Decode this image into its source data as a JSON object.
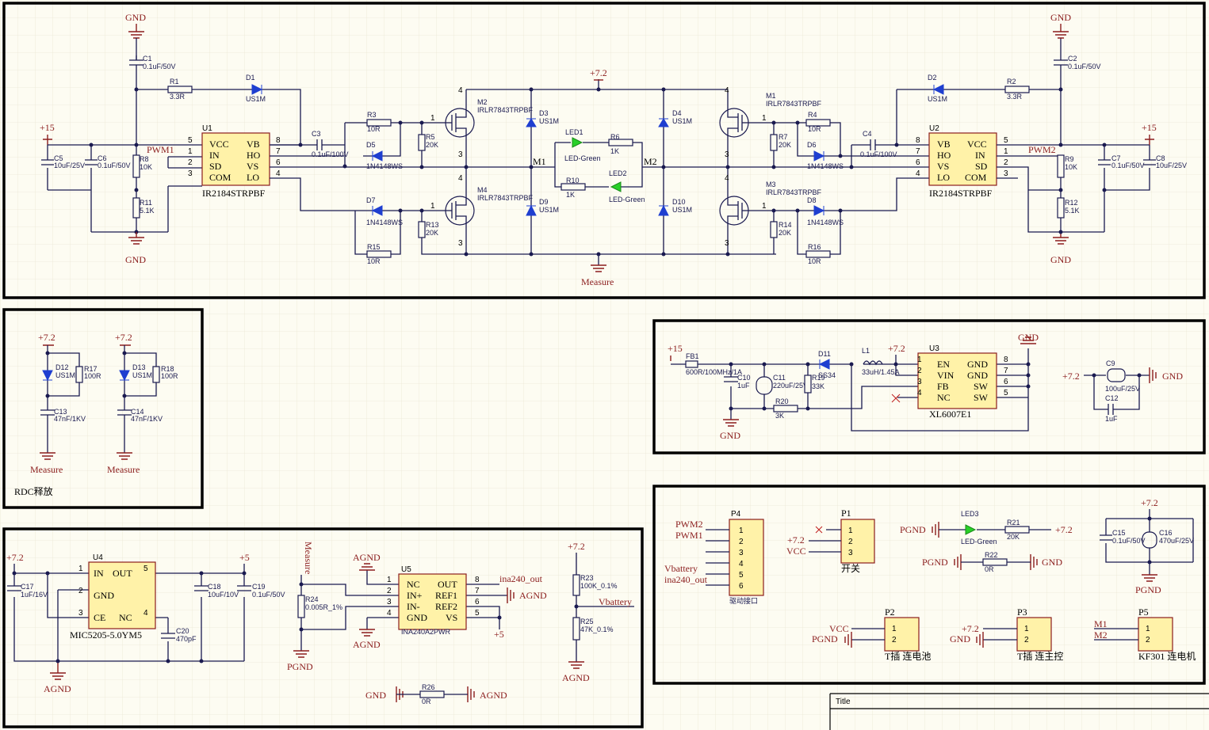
{
  "title_block": {
    "title": "Title"
  },
  "hbridge": {
    "ic_left": {
      "des": "U1",
      "part": "IR2184STRPBF",
      "pins_left": [
        "VCC",
        "IN",
        "SD",
        "COM"
      ],
      "pins_right": [
        "VB",
        "HO",
        "VS",
        "LO"
      ],
      "nums_left": [
        "5",
        "1",
        "2",
        "3"
      ],
      "nums_right": [
        "8",
        "7",
        "6",
        "4"
      ]
    },
    "ic_right": {
      "des": "U2",
      "part": "IR2184STRPBF",
      "pins_left": [
        "VB",
        "HO",
        "VS",
        "LO"
      ],
      "pins_right": [
        "VCC",
        "IN",
        "SD",
        "COM"
      ],
      "nums_left": [
        "8",
        "7",
        "6",
        "4"
      ],
      "nums_right": [
        "5",
        "1",
        "2",
        "3"
      ]
    },
    "nets": {
      "gnd": "GND",
      "p15": "+15",
      "p72": "+7.2",
      "measure": "Measure",
      "pwm1": "PWM1",
      "pwm2": "PWM2",
      "m1": "M1",
      "m2": "M2"
    },
    "parts": {
      "C1": [
        "C1",
        "0.1uF/50V"
      ],
      "C2": [
        "C2",
        "0.1uF/50V"
      ],
      "R1": [
        "R1",
        "3.3R"
      ],
      "R2": [
        "R2",
        "3.3R"
      ],
      "D1": [
        "D1",
        "US1M"
      ],
      "D2": [
        "D2",
        "US1M"
      ],
      "C3": [
        "C3",
        "0.1uF/100V"
      ],
      "C4": [
        "C4",
        "0.1uF/100V"
      ],
      "C5": [
        "C5",
        "10uF/25V"
      ],
      "C6": [
        "C6",
        "0.1uF/50V"
      ],
      "C7": [
        "C7",
        "0.1uF/50V"
      ],
      "C8": [
        "C8",
        "10uF/25V"
      ],
      "R8": [
        "R8",
        "10K"
      ],
      "R9": [
        "R9",
        "10K"
      ],
      "R11": [
        "R11",
        "5.1K"
      ],
      "R12": [
        "R12",
        "5.1K"
      ],
      "R3": [
        "R3",
        "10R"
      ],
      "R4": [
        "R4",
        "10R"
      ],
      "R5": [
        "R5",
        "20K"
      ],
      "R7": [
        "R7",
        "20K"
      ],
      "D5": [
        "D5",
        "1N4148WS"
      ],
      "D6": [
        "D6",
        "1N4148WS"
      ],
      "D7": [
        "D7",
        "1N4148WS"
      ],
      "D8": [
        "D8",
        "1N4148WS"
      ],
      "R13": [
        "R13",
        "20K"
      ],
      "R14": [
        "R14",
        "20K"
      ],
      "R15": [
        "R15",
        "10R"
      ],
      "R16": [
        "R16",
        "10R"
      ],
      "M2": [
        "M2",
        "IRLR7843TRPBF"
      ],
      "M4": [
        "M4",
        "IRLR7843TRPBF"
      ],
      "M1": [
        "M1",
        "IRLR7843TRPBF"
      ],
      "M3": [
        "M3",
        "IRLR7843TRPBF"
      ],
      "D3": [
        "D3",
        "US1M"
      ],
      "D9": [
        "D9",
        "US1M"
      ],
      "D4": [
        "D4",
        "US1M"
      ],
      "D10": [
        "D10",
        "US1M"
      ],
      "LED1": [
        "LED1",
        "LED-Green"
      ],
      "LED2": [
        "LED2",
        "LED-Green"
      ],
      "R6": [
        "R6",
        "1K"
      ],
      "R10": [
        "R10",
        "1K"
      ]
    }
  },
  "rdc": {
    "title": "RDC释放",
    "p72": "+7.2",
    "measure": "Measure",
    "D12": [
      "D12",
      "US1M"
    ],
    "R17": [
      "R17",
      "100R"
    ],
    "C13": [
      "C13",
      "47nF/1KV"
    ],
    "D13": [
      "D13",
      "US1M"
    ],
    "R18": [
      "R18",
      "100R"
    ],
    "C14": [
      "C14",
      "47nF/1KV"
    ]
  },
  "sense": {
    "u4": {
      "des": "U4",
      "part": "MIC5205-5.0YM5",
      "pins": [
        "IN",
        "OUT",
        "GND",
        "CE",
        "NC"
      ],
      "nums": [
        "1",
        "5",
        "2",
        "3",
        "4"
      ]
    },
    "u5": {
      "des": "U5",
      "part": "INA240A2PWR",
      "pins_left": [
        "NC",
        "IN+",
        "IN-",
        "GND"
      ],
      "pins_right": [
        "OUT",
        "REF1",
        "REF2",
        "VS"
      ],
      "nums_left": [
        "1",
        "2",
        "3",
        "4"
      ],
      "nums_right": [
        "8",
        "7",
        "6",
        "5"
      ]
    },
    "nets": {
      "p72": "+7.2",
      "p5": "+5",
      "agnd": "AGND",
      "pgnd": "PGND",
      "gnd": "GND",
      "measure": "Measure",
      "ina_out": "ina240_out",
      "vbat": "Vbattery"
    },
    "C17": [
      "C17",
      "1uF/16V"
    ],
    "C18": [
      "C18",
      "10uF/10V"
    ],
    "C19": [
      "C19",
      "0.1uF/50V"
    ],
    "C20": [
      "C20",
      "470pF"
    ],
    "R24": [
      "R24",
      "0.005R_1%"
    ],
    "R23": [
      "R23",
      "100K_0.1%"
    ],
    "R25": [
      "R25",
      "47K_0.1%"
    ],
    "R26": [
      "R26",
      "0R"
    ]
  },
  "buck": {
    "u3": {
      "des": "U3",
      "part": "XL6007E1",
      "pins_left": [
        "EN",
        "VIN",
        "FB",
        "NC"
      ],
      "pins_right": [
        "GND",
        "GND",
        "SW",
        "SW"
      ],
      "nums_left": [
        "1",
        "2",
        "3",
        "4"
      ],
      "nums_right": [
        "8",
        "7",
        "6",
        "5"
      ]
    },
    "nets": {
      "p15": "+15",
      "p72": "+7.2",
      "gnd": "GND"
    },
    "FB1": [
      "FB1",
      "600R/100MHz/1A"
    ],
    "C10": [
      "C10",
      "1uF"
    ],
    "C11": [
      "C11",
      "220uF/25V"
    ],
    "D11": [
      "D11",
      "SS34"
    ],
    "R19": [
      "R19",
      "33K"
    ],
    "R20": [
      "R20",
      "3K"
    ],
    "L1": [
      "L1",
      "33uH/1.45A"
    ],
    "C9": [
      "C9",
      "100uF/25V"
    ],
    "C12": [
      "C12",
      "1uF"
    ]
  },
  "connectors": {
    "p4": {
      "des": "P4",
      "label": "驱动接口",
      "pins": [
        "1",
        "2",
        "3",
        "4",
        "5",
        "6"
      ],
      "nets": [
        "PWM2",
        "PWM1",
        "Vbattery",
        "ina240_out"
      ]
    },
    "p1": {
      "des": "P1",
      "label": "开关",
      "pins": [
        "1",
        "2",
        "3"
      ],
      "nets": [
        "+7.2",
        "VCC"
      ]
    },
    "p2": {
      "des": "P2",
      "label": "T插 连电池",
      "pins": [
        "1",
        "2"
      ],
      "nets": [
        "VCC",
        "PGND"
      ]
    },
    "p3": {
      "des": "P3",
      "label": "T插 连主控",
      "pins": [
        "1",
        "2"
      ],
      "nets": [
        "+7.2",
        "GND"
      ]
    },
    "p5": {
      "des": "P5",
      "label": "KF301 连电机",
      "pins": [
        "1",
        "2"
      ],
      "nets": [
        "M1",
        "M2"
      ]
    },
    "led3": [
      "LED3",
      "LED-Green"
    ],
    "R21": [
      "R21",
      "20K"
    ],
    "R22": [
      "R22",
      "0R"
    ],
    "C15": [
      "C15",
      "0.1uF/50V"
    ],
    "C16": [
      "C16",
      "470uF/25V"
    ],
    "misc": {
      "pgnd": "PGND",
      "gnd": "GND",
      "p72": "+7.2"
    }
  }
}
